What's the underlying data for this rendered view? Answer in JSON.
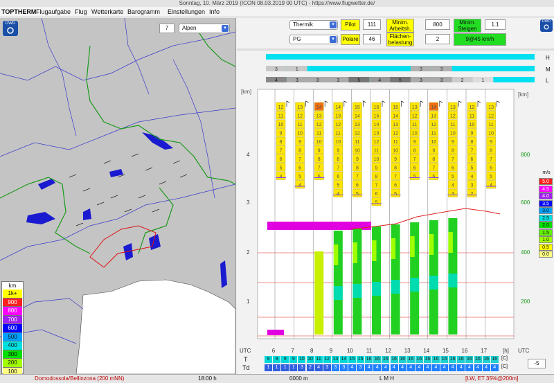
{
  "window": {
    "title": "Sonntag, 10. März 2019 (ICON 08.03.2019 00 UTC) - https://www.flugwetter.de/"
  },
  "menu": [
    "TOPTHERM",
    "Flugaufgabe",
    "Flug",
    "Wetterkarte",
    "Barogramm",
    "Einstellungen",
    "Info"
  ],
  "map": {
    "zoom_value": "7",
    "region": "Alpen",
    "logo": "DWD",
    "legend_title": "km",
    "legend": [
      {
        "label": "1k+",
        "color": "#ffff00"
      },
      {
        "label": "900",
        "color": "#ff2020"
      },
      {
        "label": "800",
        "color": "#ff00ff"
      },
      {
        "label": "700",
        "color": "#a020f0"
      },
      {
        "label": "600",
        "color": "#0000ff"
      },
      {
        "label": "500",
        "color": "#00a0ff"
      },
      {
        "label": "400",
        "color": "#00e0e0"
      },
      {
        "label": "300",
        "color": "#00e000"
      },
      {
        "label": "200",
        "color": "#a0ff00"
      },
      {
        "label": "100",
        "color": "#ffff80"
      }
    ]
  },
  "controls": {
    "mode": "Thermik",
    "glider": "PG",
    "pilot_label": "Pilot",
    "pilot_value": "111",
    "polare_label": "Polare",
    "polare_value": "46",
    "min_arbeit_label": "Minim. Arbeitsh.",
    "min_arbeit_value": "800",
    "flaechen_label": "Flächen-belastung",
    "flaechen_value": "2",
    "min_steigen_label": "Minim. Steigen",
    "min_steigen_value": "1.1",
    "wind_value": "9@45 km/h"
  },
  "cloud_layers": {
    "H": "H",
    "M": "M",
    "L": "L"
  },
  "m_row_values": [
    "3",
    "1",
    "",
    "",
    "",
    "",
    "",
    "3",
    "3",
    "",
    "",
    "",
    ""
  ],
  "l_row_values": [
    "4",
    "3",
    "3",
    "3",
    "5",
    "4",
    "5",
    "3",
    "3",
    "2",
    "1",
    "",
    ""
  ],
  "axis": {
    "left_unit": "[km]",
    "right_unit": "[km]",
    "left_ticks": [
      "4",
      "3",
      "2",
      "1"
    ],
    "right_ticks": [
      "800",
      "600",
      "400",
      "200"
    ],
    "hours": [
      "6",
      "7",
      "8",
      "9",
      "10",
      "11",
      "12",
      "13",
      "14",
      "15",
      "16",
      "17"
    ],
    "hour_unit": "[h]",
    "utc_left": "UTC",
    "utc_right": "UTC"
  },
  "ms_legend": {
    "title": "m/s",
    "items": [
      {
        "label": "5.0",
        "color": "#ff2020"
      },
      {
        "label": "4.5",
        "color": "#ff00ff"
      },
      {
        "label": "4.0",
        "color": "#a020f0"
      },
      {
        "label": "3.5",
        "color": "#0000ff"
      },
      {
        "label": "3.0",
        "color": "#00a0ff"
      },
      {
        "label": "2.5",
        "color": "#00e0e0"
      },
      {
        "label": "2.0",
        "color": "#00e000"
      },
      {
        "label": "1.5",
        "color": "#60f000"
      },
      {
        "label": "1.0",
        "color": "#a0ff00"
      },
      {
        "label": "0.5",
        "color": "#ffff00"
      },
      {
        "label": "0.0",
        "color": "#ffff80"
      }
    ]
  },
  "temps": {
    "t_label": "T",
    "td_label": "Td",
    "unit": "[C]",
    "t_values": [
      "9",
      "9",
      "9",
      "9",
      "10",
      "10",
      "11",
      "12",
      "13",
      "14",
      "15",
      "15",
      "16",
      "16",
      "16",
      "16",
      "16",
      "16",
      "16",
      "16",
      "16",
      "16",
      "16",
      "16",
      "16",
      "16",
      "16",
      "16"
    ],
    "td_values": [
      "1",
      "1",
      "1",
      "1",
      "3",
      "2",
      "4",
      "3",
      "3",
      "3",
      "4",
      "3",
      "4",
      "4",
      "4",
      "4",
      "4",
      "4",
      "4",
      "4",
      "4",
      "4",
      "4",
      "4",
      "4",
      "4",
      "4",
      "4"
    ],
    "offset_value": "-5"
  },
  "status": {
    "location": "Domodossola/Bellinzona (200 mNN)",
    "time": "18:00 h",
    "altitude": "0000 m",
    "layers": "L M H",
    "info": "[LW, ET 35%@200m]"
  },
  "bar_columns": [
    {
      "hour": "6",
      "top": [
        12,
        11,
        10,
        9,
        8,
        7,
        6,
        5,
        4
      ],
      "cap": ""
    },
    {
      "hour": "7",
      "top": [
        13,
        12,
        11,
        10,
        9,
        8,
        7,
        6,
        5,
        4
      ],
      "cap": ""
    },
    {
      "hour": "8",
      "top": [
        14,
        13,
        12,
        11,
        10,
        9,
        8,
        7,
        6
      ],
      "cap": "orange"
    },
    {
      "hour": "9",
      "top": [
        14,
        13,
        12,
        11,
        10,
        9,
        8,
        7,
        6,
        5,
        4
      ],
      "cap": ""
    },
    {
      "hour": "10",
      "top": [
        15,
        14,
        13,
        12,
        11,
        10,
        9,
        8,
        7,
        6,
        5
      ],
      "cap": ""
    },
    {
      "hour": "11",
      "top": [
        16,
        15,
        14,
        13,
        12,
        11,
        10,
        9,
        8,
        7,
        6,
        5
      ],
      "cap": ""
    },
    {
      "hour": "12",
      "top": [
        15,
        14,
        13,
        12,
        11,
        10,
        9,
        8,
        7,
        6,
        5
      ],
      "cap": ""
    },
    {
      "hour": "13",
      "top": [
        13,
        12,
        11,
        10,
        9,
        8,
        7,
        6,
        5
      ],
      "cap": ""
    },
    {
      "hour": "14",
      "top": [
        14,
        13,
        12,
        11,
        10,
        9,
        8,
        7,
        6
      ],
      "cap": "orange"
    },
    {
      "hour": "15",
      "top": [
        13,
        12,
        11,
        10,
        9,
        8,
        7,
        6,
        5,
        4,
        3
      ],
      "cap": ""
    },
    {
      "hour": "16",
      "top": [
        12,
        11,
        10,
        9,
        8,
        7,
        6,
        5,
        4,
        3,
        2
      ],
      "cap": ""
    },
    {
      "hour": "17",
      "top": [
        13,
        12,
        11,
        10,
        9,
        8,
        7,
        6,
        5,
        4
      ],
      "cap": ""
    }
  ]
}
